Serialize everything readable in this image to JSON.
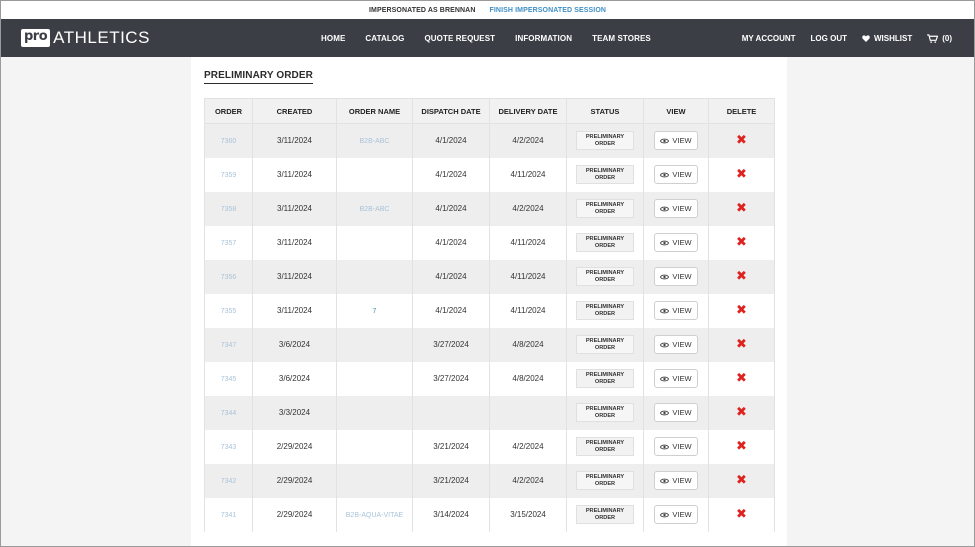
{
  "impersonation": {
    "label": "IMPERSONATED AS BRENNAN",
    "finish_link": "FINISH IMPERSONATED SESSION"
  },
  "header": {
    "logo_badge": "pro",
    "logo_word": "ATHLETICS",
    "nav": [
      "HOME",
      "CATALOG",
      "QUOTE REQUEST",
      "INFORMATION",
      "TEAM STORES"
    ],
    "my_account": "MY ACCOUNT",
    "log_out": "LOG OUT",
    "wishlist": "WISHLIST",
    "cart_count": "(0)"
  },
  "page": {
    "title": "PRELIMINARY ORDER"
  },
  "table": {
    "headers": [
      "ORDER",
      "CREATED",
      "ORDER NAME",
      "DISPATCH DATE",
      "DELIVERY DATE",
      "STATUS",
      "VIEW",
      "DELETE"
    ],
    "status_line1": "PRELIMINARY",
    "status_line2": "ORDER",
    "view_label": "VIEW",
    "delete_symbol": "✖",
    "rows": [
      {
        "order": "7360",
        "created": "3/11/2024",
        "name": "B2B-ABC",
        "dispatch": "4/1/2024",
        "delivery": "4/2/2024"
      },
      {
        "order": "7359",
        "created": "3/11/2024",
        "name": "",
        "dispatch": "4/1/2024",
        "delivery": "4/11/2024"
      },
      {
        "order": "7358",
        "created": "3/11/2024",
        "name": "B2B-ABC",
        "dispatch": "4/1/2024",
        "delivery": "4/2/2024"
      },
      {
        "order": "7357",
        "created": "3/11/2024",
        "name": "",
        "dispatch": "4/1/2024",
        "delivery": "4/11/2024"
      },
      {
        "order": "7356",
        "created": "3/11/2024",
        "name": "",
        "dispatch": "4/1/2024",
        "delivery": "4/11/2024"
      },
      {
        "order": "7355",
        "created": "3/11/2024",
        "name": "7",
        "dispatch": "4/1/2024",
        "delivery": "4/11/2024"
      },
      {
        "order": "7347",
        "created": "3/6/2024",
        "name": "",
        "dispatch": "3/27/2024",
        "delivery": "4/8/2024"
      },
      {
        "order": "7345",
        "created": "3/6/2024",
        "name": "",
        "dispatch": "3/27/2024",
        "delivery": "4/8/2024"
      },
      {
        "order": "7344",
        "created": "3/3/2024",
        "name": "",
        "dispatch": "",
        "delivery": ""
      },
      {
        "order": "7343",
        "created": "2/29/2024",
        "name": "",
        "dispatch": "3/21/2024",
        "delivery": "4/2/2024"
      },
      {
        "order": "7342",
        "created": "2/29/2024",
        "name": "",
        "dispatch": "3/21/2024",
        "delivery": "4/2/2024"
      },
      {
        "order": "7341",
        "created": "2/29/2024",
        "name": "B2B-AQUA-VITAE",
        "dispatch": "3/14/2024",
        "delivery": "3/15/2024"
      }
    ]
  },
  "colors": {
    "navbar_bg": "#3b3f45",
    "link_blue": "#3f8fc4",
    "delete_red": "#e0221f"
  },
  "icons": {
    "wishlist": "heart-icon",
    "cart": "cart-icon",
    "view": "eye-icon",
    "delete": "x-icon"
  }
}
